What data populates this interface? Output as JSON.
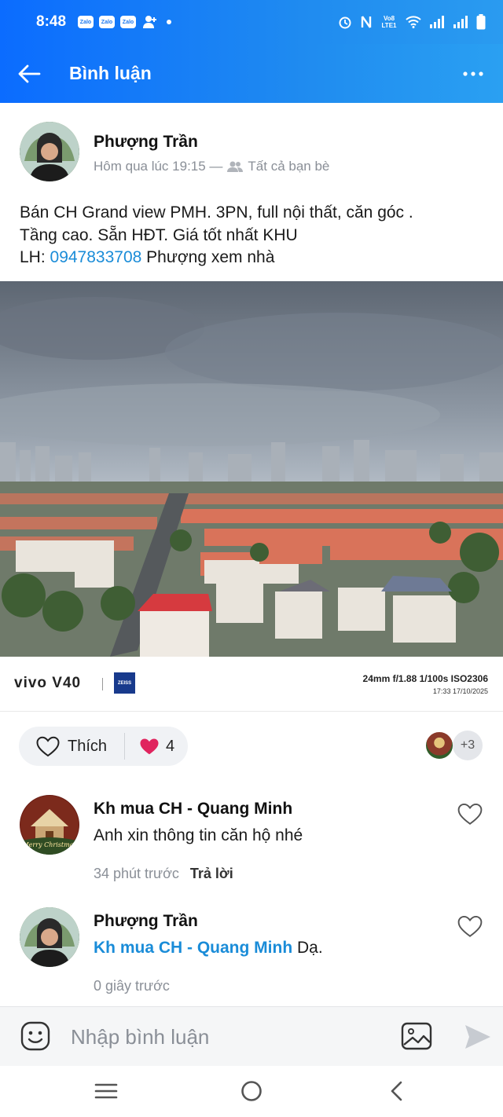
{
  "status_bar": {
    "time": "8:48",
    "zalo_icon_label": "Zalo",
    "network_label": "Vo8 LTE1",
    "icons": [
      "zalo-icon",
      "zalo-icon",
      "zalo-icon",
      "person-add-icon",
      "dot-icon",
      "alarm-icon",
      "nfc-icon",
      "wifi-icon",
      "signal-icon",
      "signal-icon",
      "battery-icon"
    ]
  },
  "header": {
    "title": "Bình luận",
    "back_icon": "back-arrow-icon",
    "more_icon": "more-icon"
  },
  "post": {
    "author": "Phượng Trần",
    "time": "Hôm qua lúc 19:15 —",
    "audience": "Tất cả bạn bè",
    "text_line1": "Bán CH Grand view PMH. 3PN, full nội thất, căn góc .",
    "text_line2": "Tầng cao. Sẵn HĐT. Giá tốt nhất KHU",
    "text_line3_prefix": "LH: ",
    "phone": "0947833708",
    "text_line3_suffix": " Phượng xem nhà",
    "photo_watermark": {
      "brand": "vivo V40",
      "lens_brand": "ZEISS",
      "specs": "24mm  f/1.88  1/100s  ISO2306",
      "datetime": "17:33 17/10/2025"
    }
  },
  "reactions": {
    "like_label": "Thích",
    "heart_count": "4",
    "others_count": "+3"
  },
  "comments": [
    {
      "author": "Kh mua CH - Quang Minh",
      "text": "Anh xin thông tin căn hộ nhé",
      "time": "34 phút trước",
      "reply_label": "Trả lời",
      "avatar_text": "Merry Christmas"
    },
    {
      "author": "Phượng Trần",
      "mention": "Kh mua CH - Quang Minh",
      "text": " Dạ.",
      "time": "0 giây trước"
    }
  ],
  "composer": {
    "placeholder": "Nhập bình luận"
  },
  "navbar": {
    "icons": [
      "recents-icon",
      "home-icon",
      "back-icon"
    ]
  },
  "colors": {
    "header_blue": "#1f8bf0",
    "link_blue": "#1a8cd8",
    "heart_red": "#e0245e"
  }
}
